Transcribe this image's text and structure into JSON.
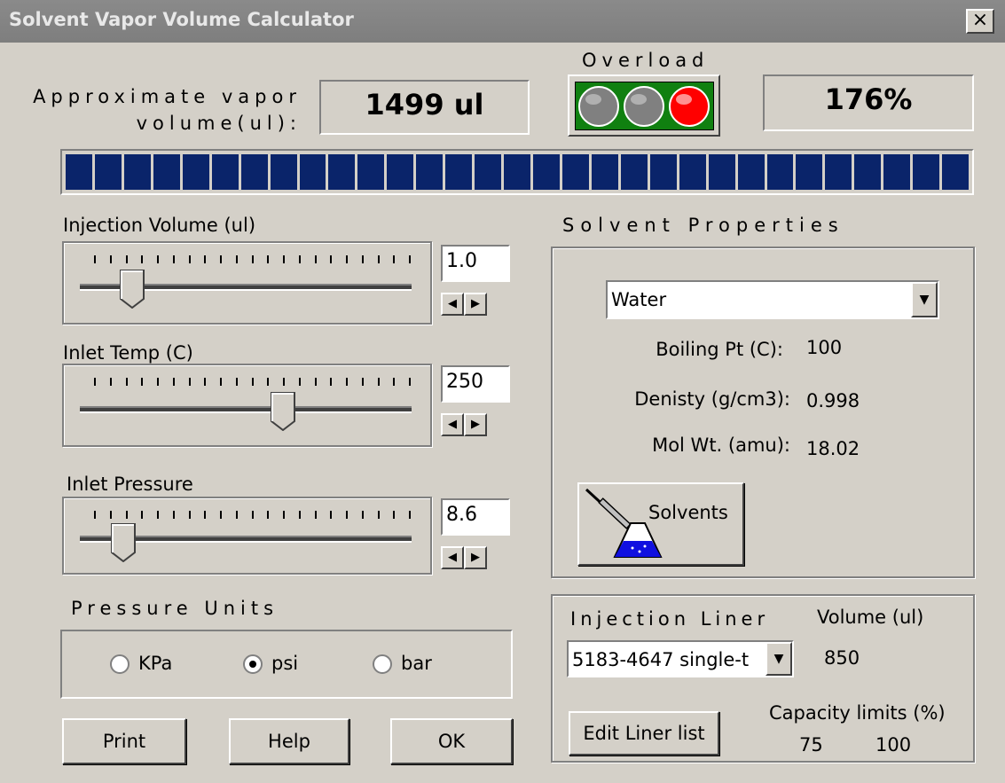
{
  "window": {
    "title": "Solvent Vapor Volume Calculator",
    "close_glyph": "×"
  },
  "summary": {
    "approx_label_line1": "Approximate vapor",
    "approx_label_line2": "volume(ul):",
    "vapor_volume": "1499 ul",
    "overload_label": "Overload",
    "overload_lights": [
      "off",
      "off",
      "on"
    ],
    "overload_percent": "176%",
    "progress_fraction": 1.0,
    "progress_color": "#0a246a"
  },
  "injection_volume": {
    "label": "Injection Volume (ul)",
    "value": "1.0",
    "slider_fraction": 0.12
  },
  "inlet_temp": {
    "label": "Inlet Temp (C)",
    "value": "250",
    "slider_fraction": 0.62
  },
  "inlet_pressure": {
    "label": "Inlet Pressure",
    "value": "8.6",
    "slider_fraction": 0.09
  },
  "spinner": {
    "left_icon": "arrow-left-icon",
    "right_icon": "arrow-right-icon"
  },
  "pressure_units": {
    "label": "Pressure Units",
    "options": [
      {
        "label": "KPa",
        "checked": false
      },
      {
        "label": "psi",
        "checked": true
      },
      {
        "label": "bar",
        "checked": false
      }
    ]
  },
  "buttons": {
    "print": "Print",
    "help": "Help",
    "ok": "OK"
  },
  "solvent": {
    "heading": "Solvent Properties",
    "selected": "Water",
    "boiling_label": "Boiling Pt (C):",
    "boiling_value": "100",
    "density_label": "Denisty (g/cm3):",
    "density_value": "0.998",
    "molwt_label": "Mol Wt. (amu):",
    "molwt_value": "18.02",
    "solvents_button": "Solvents",
    "solvents_icon": "syringe-flask-icon"
  },
  "liner": {
    "heading": "Injection Liner",
    "volume_label": "Volume (ul)",
    "selected": "5183-4647 single-t",
    "volume_value": "850",
    "edit_button": "Edit Liner list",
    "capacity_label": "Capacity limits (%)",
    "capacity_low": "75",
    "capacity_high": "100"
  }
}
